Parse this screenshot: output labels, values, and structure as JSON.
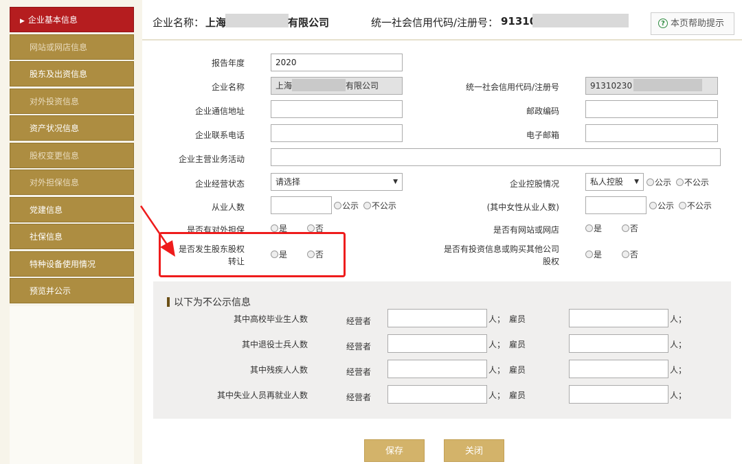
{
  "sidebar": {
    "items": [
      {
        "label": "企业基本信息"
      },
      {
        "label": "网站或网店信息"
      },
      {
        "label": "股东及出资信息"
      },
      {
        "label": "对外投资信息"
      },
      {
        "label": "资产状况信息"
      },
      {
        "label": "股权变更信息"
      },
      {
        "label": "对外担保信息"
      },
      {
        "label": "党建信息"
      },
      {
        "label": "社保信息"
      },
      {
        "label": "特种设备使用情况"
      },
      {
        "label": "预览并公示"
      }
    ]
  },
  "header": {
    "name_label": "企业名称：",
    "name_prefix": "上海",
    "name_suffix": "有限公司",
    "code_label": "统一社会信用代码/注册号：",
    "code_value": "91310",
    "help_label": "本页帮助提示",
    "help_icon_glyph": "?"
  },
  "form": {
    "report_year_label": "报告年度",
    "report_year_value": "2020",
    "company_name_label": "企业名称",
    "company_name_prefix": "上海",
    "company_name_suffix": "有限公司",
    "credit_code_label": "统一社会信用代码/注册号",
    "credit_code_value": "91310230",
    "address_label": "企业通信地址",
    "postcode_label": "邮政编码",
    "phone_label": "企业联系电话",
    "email_label": "电子邮箱",
    "business_label": "企业主营业务活动",
    "status_label": "企业经营状态",
    "status_value": "请选择",
    "holding_label": "企业控股情况",
    "holding_value": "私人控股",
    "employees_label": "从业人数",
    "female_label": "(其中女性从业人数)",
    "guarantee_label": "是否有对外担保",
    "website_label": "是否有网站或网店",
    "transfer_label_1": "是否发生股东股权",
    "transfer_label_2": "转让",
    "invest_label_1": "是否有投资信息或购买其他公司",
    "invest_label_2": "股权",
    "yes": "是",
    "no": "否",
    "public": "公示",
    "nonpublic": "不公示"
  },
  "nonpublic_section": {
    "title": "以下为不公示信息",
    "operator_label": "经营者",
    "person_sep": "人；",
    "employee_label": "雇员",
    "person_end": "人；",
    "rows": [
      {
        "label": "其中高校毕业生人数"
      },
      {
        "label": "其中退役士兵人数"
      },
      {
        "label": "其中残疾人人数"
      },
      {
        "label": "其中失业人员再就业人数"
      }
    ]
  },
  "buttons": {
    "save": "保存",
    "close": "关闭"
  },
  "colors": {
    "sidebar_active": "#b51d1f",
    "sidebar_item": "#ad8d41",
    "button": "#d3b36a",
    "annotation": "#ee1c1c"
  }
}
